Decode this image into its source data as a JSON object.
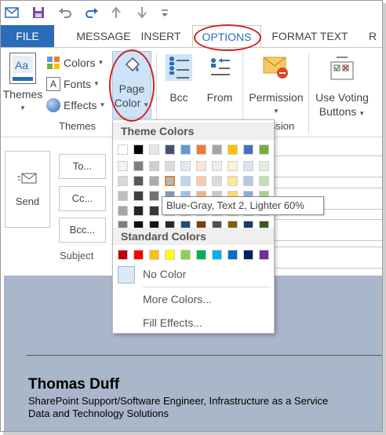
{
  "tabs": {
    "file": "FILE",
    "message": "MESSAGE",
    "insert": "INSERT",
    "options": "OPTIONS",
    "format_text": "FORMAT TEXT",
    "review": "R"
  },
  "ribbon": {
    "themes_label": "Themes",
    "colors_label": "Colors",
    "fonts_label": "Fonts",
    "effects_label": "Effects",
    "page_color_line1": "Page",
    "page_color_line2": "Color",
    "bcc_label": "Bcc",
    "from_label": "From",
    "permission_label": "Permission",
    "voting_line1": "Use Voting",
    "voting_line2": "Buttons",
    "group_themes": "Themes",
    "group_permission_partial": "ission",
    "themes_icon_text": "Aa"
  },
  "compose": {
    "send_label": "Send",
    "to_label": "To...",
    "cc_label": "Cc...",
    "bcc_label": "Bcc...",
    "subject_label": "Subject"
  },
  "dropdown": {
    "theme_colors_heading": "Theme Colors",
    "standard_colors_heading": "Standard Colors",
    "no_color": "No Color",
    "more_colors": "More Colors...",
    "fill_effects": "Fill Effects..."
  },
  "tooltip": "Blue-Gray, Text 2, Lighter 60%",
  "signature": {
    "name": "Thomas Duff",
    "line1": "SharePoint Support/Software Engineer, Infrastructure as a Service",
    "line2": "Data and Technology Solutions"
  },
  "colors": {
    "accent": "#2b6cb9",
    "highlight_oval": "#d6201f",
    "body_background": "#aab6c9",
    "theme_top_row": [
      "#ffffff",
      "#000000",
      "#e7e6e6",
      "#44546a",
      "#5b9bd5",
      "#ed7d31",
      "#a5a5a5",
      "#ffc000",
      "#4472c4",
      "#70ad47"
    ],
    "theme_columns": [
      [
        "#f2f2f2",
        "#d9d9d9",
        "#bfbfbf",
        "#a6a6a6",
        "#7f7f7f"
      ],
      [
        "#7f7f7f",
        "#595959",
        "#404040",
        "#262626",
        "#0d0d0d"
      ],
      [
        "#d0cece",
        "#aeaaaa",
        "#757070",
        "#3a3838",
        "#171616"
      ],
      [
        "#d6dce4",
        "#adb9ca",
        "#8497b0",
        "#333f4f",
        "#222a35"
      ],
      [
        "#deebf6",
        "#bdd7ee",
        "#9dc3e6",
        "#2e75b5",
        "#1e4e79"
      ],
      [
        "#fbe5d5",
        "#f7cbac",
        "#f4b183",
        "#c55a11",
        "#843c0b"
      ],
      [
        "#ededed",
        "#dbdbdb",
        "#c9c9c9",
        "#7b7b7b",
        "#525252"
      ],
      [
        "#fff2cc",
        "#ffe599",
        "#ffd966",
        "#bf9000",
        "#7f6000"
      ],
      [
        "#dae3f3",
        "#b4c7e7",
        "#8faadc",
        "#2f5496",
        "#1f3864"
      ],
      [
        "#e2efd9",
        "#c5e0b3",
        "#a8d08d",
        "#538135",
        "#375623"
      ]
    ],
    "standard": [
      "#c00000",
      "#ff0000",
      "#ffc000",
      "#ffff00",
      "#92d050",
      "#00b050",
      "#00b0f0",
      "#0070c0",
      "#002060",
      "#7030a0"
    ]
  },
  "icons": {
    "app": "outlook-envelope-icon",
    "save": "save-icon",
    "undo": "undo-icon",
    "redo": "redo-icon",
    "up": "arrow-up-icon",
    "down": "arrow-down-icon",
    "customize": "customize-qat-icon"
  }
}
